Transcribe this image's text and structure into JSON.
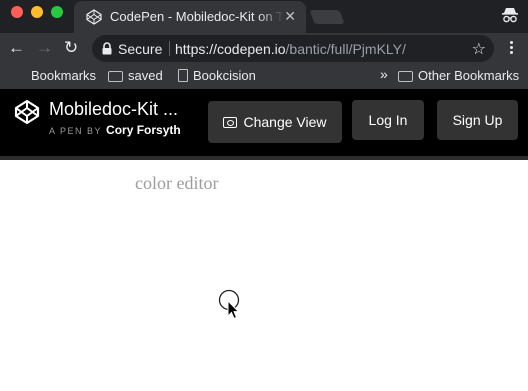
{
  "browser": {
    "tab_title": "CodePen - Mobiledoc-Kit on Text Editor",
    "tab_close": "✕",
    "security_label": "Secure",
    "url_host": "https://codepen.io",
    "url_path": "/bantic/full/PjmKLY/",
    "nav": {
      "back": "←",
      "forward": "→",
      "reload": "↻",
      "star": "☆"
    }
  },
  "bookmarks_bar": {
    "items": [
      {
        "label": "Bookmarks",
        "icon": "none"
      },
      {
        "label": "saved",
        "icon": "folder-icon"
      },
      {
        "label": "Bookcision",
        "icon": "page-icon"
      }
    ],
    "overflow": "»",
    "other": "Other Bookmarks"
  },
  "codepen": {
    "pen_title": "Mobiledoc-Kit ...",
    "pen_by": "A PEN BY",
    "author": "Cory Forsyth",
    "buttons": {
      "change_view": "Change View",
      "log_in": "Log In",
      "sign_up": "Sign Up"
    }
  },
  "content": {
    "editor_title": "color editor"
  },
  "colors": {
    "chrome_dark": "#202124",
    "chrome_mid": "#35363a",
    "codepen_header": "#000000",
    "button_bg": "#333333",
    "editor_title": "#9d9d9d"
  }
}
